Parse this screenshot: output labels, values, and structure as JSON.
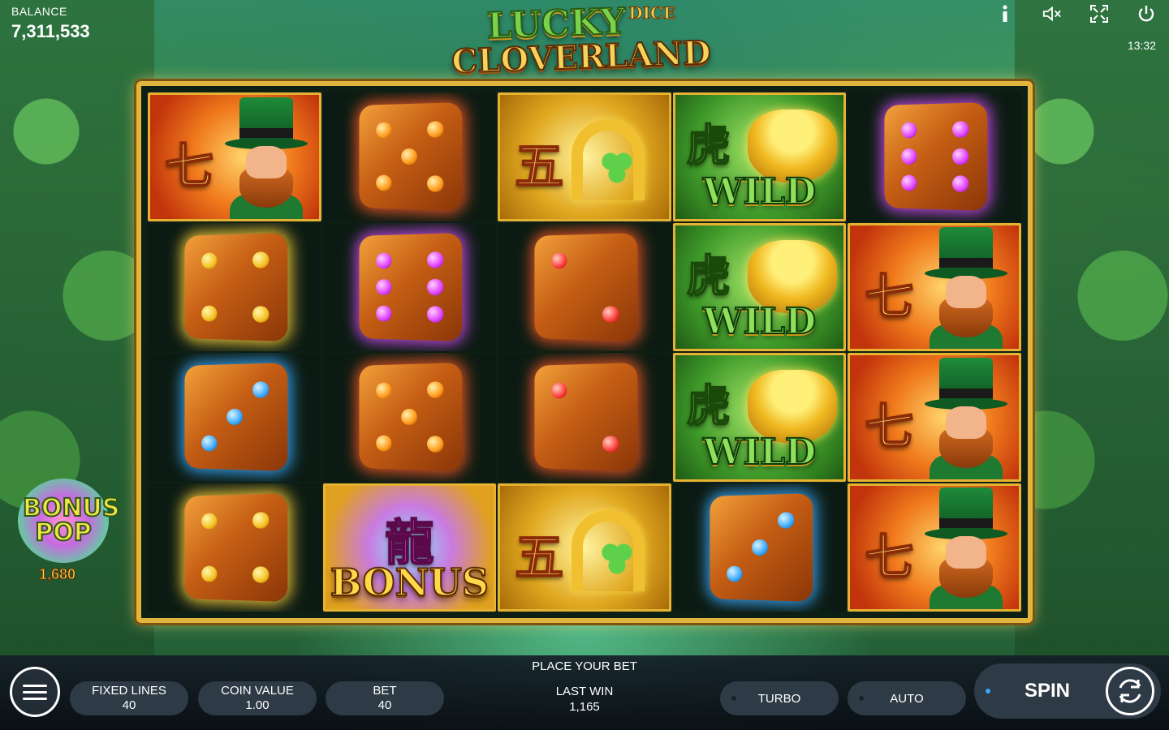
{
  "hud": {
    "balance_label": "BALANCE",
    "balance_value": "7,311,533",
    "clock": "13:32",
    "icons": [
      "info-icon",
      "sound-muted-icon",
      "fullscreen-icon",
      "power-icon"
    ]
  },
  "logo": {
    "line1": "LUCKY",
    "line1_small": "DICE",
    "line2": "CLOVERLAND"
  },
  "reels": {
    "columns": [
      [
        {
          "type": "leprechaun",
          "char": "七"
        },
        {
          "type": "die",
          "color": "gold",
          "pips": 4
        },
        {
          "type": "die",
          "color": "blue",
          "pips": 3
        },
        {
          "type": "die",
          "color": "gold",
          "pips": 4
        }
      ],
      [
        {
          "type": "die",
          "color": "orange",
          "pips": 5
        },
        {
          "type": "die",
          "color": "purple",
          "pips": 6
        },
        {
          "type": "die",
          "color": "orange",
          "pips": 5
        },
        {
          "type": "bonus",
          "char": "龍",
          "text": "BONUS"
        }
      ],
      [
        {
          "type": "horseshoe",
          "char": "五"
        },
        {
          "type": "die",
          "color": "red",
          "pips": 2
        },
        {
          "type": "die",
          "color": "red",
          "pips": 2
        },
        {
          "type": "horseshoe",
          "char": "五"
        }
      ],
      [
        {
          "type": "wild",
          "char": "虎",
          "text": "WILD"
        },
        {
          "type": "wild",
          "char": "虎",
          "text": "WILD"
        },
        {
          "type": "wild",
          "char": "虎",
          "text": "WILD"
        },
        {
          "type": "die",
          "color": "blue",
          "pips": 3
        }
      ],
      [
        {
          "type": "die",
          "color": "purple",
          "pips": 6
        },
        {
          "type": "leprechaun",
          "char": "七"
        },
        {
          "type": "leprechaun",
          "char": "七"
        },
        {
          "type": "leprechaun",
          "char": "七"
        }
      ]
    ]
  },
  "bonus_pop": {
    "title_line1": "BONUS",
    "title_line2": "POP",
    "value": "1,680"
  },
  "bottom": {
    "place_bet": "PLACE YOUR BET",
    "fixed_lines_label": "FIXED LINES",
    "fixed_lines_value": "40",
    "coin_value_label": "COIN VALUE",
    "coin_value_value": "1.00",
    "bet_label": "BET",
    "bet_value": "40",
    "last_win_label": "LAST WIN",
    "last_win_value": "1,165",
    "turbo_label": "TURBO",
    "auto_label": "AUTO",
    "spin_label": "SPIN"
  }
}
